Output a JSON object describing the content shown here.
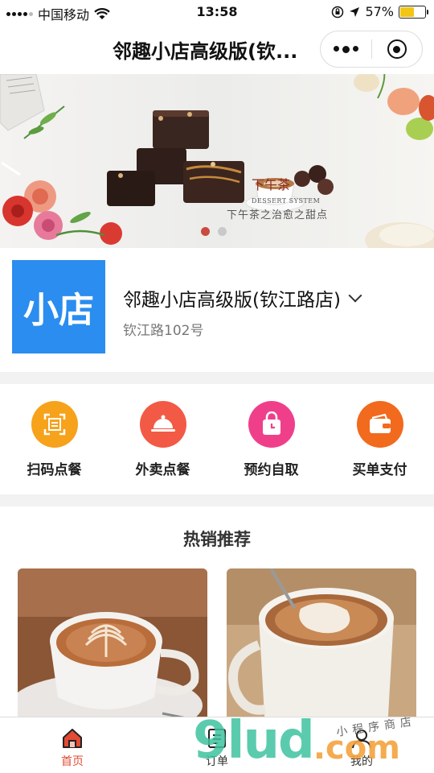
{
  "status_bar": {
    "carrier": "中国移动",
    "time": "13:58",
    "battery": "57%",
    "battery_level": 0.57
  },
  "nav": {
    "title": "邻趣小店高级版(钦..."
  },
  "banner": {
    "title": "下午茶",
    "en": "DESSERT SYSTEM",
    "subtitle": "下午茶之治愈之甜点",
    "slide_count": 2,
    "active_slide": 0
  },
  "shop": {
    "logo_text": "小店",
    "name": "邻趣小店高级版(钦江路店)",
    "address": "钦江路102号"
  },
  "actions": [
    {
      "label": "扫码点餐",
      "icon": "scan-icon",
      "color": "#f7a21b"
    },
    {
      "label": "外卖点餐",
      "icon": "food-cover-icon",
      "color": "#f25a45"
    },
    {
      "label": "预约自取",
      "icon": "shopping-bag-clock-icon",
      "color": "#ef3f8b"
    },
    {
      "label": "买单支付",
      "icon": "wallet-icon",
      "color": "#f26a1e"
    }
  ],
  "hot": {
    "title": "热销推荐"
  },
  "tabs": [
    {
      "label": "首页",
      "icon": "home-icon",
      "active": true
    },
    {
      "label": "订单",
      "icon": "order-icon",
      "active": false
    },
    {
      "label": "我的",
      "icon": "user-icon",
      "active": false
    }
  ],
  "watermark": {
    "main": "9lud",
    "suffix": ".com",
    "small": "小程序商店"
  }
}
